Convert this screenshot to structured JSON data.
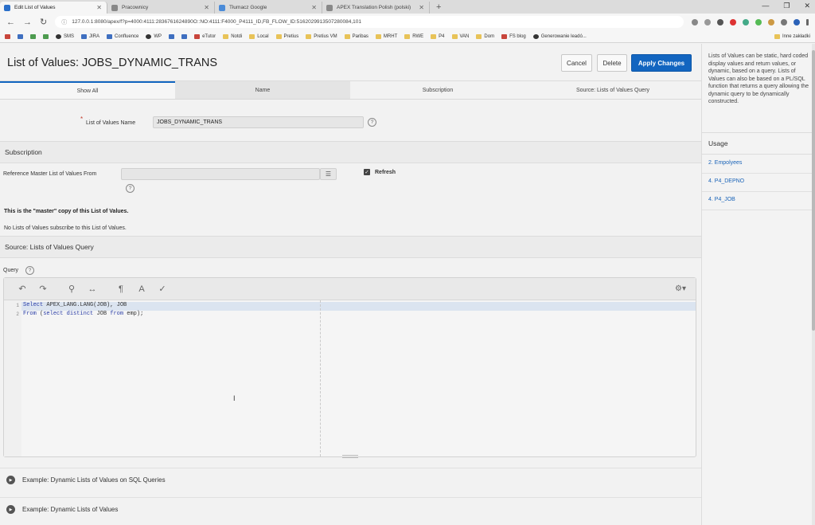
{
  "browser": {
    "tabs": [
      {
        "label": "Edit List of Values"
      },
      {
        "label": "Pracownicy"
      },
      {
        "label": "Tłumacz Google"
      },
      {
        "label": "APEX Translation Polish (polski)"
      }
    ],
    "url": "127.0.0.1:8080/apex/f?p=4000:4111:2836761624890O::NO:4111:F4000_P4111_ID,FB_FLOW_ID:5162029913507280084,101",
    "bookmarks": [
      "SMS",
      "JIRA",
      "Confluence",
      "WP",
      "eTutor",
      "Notdi",
      "Local",
      "Pretius",
      "Pretius VM",
      "Paribas",
      "MRHT",
      "RWE",
      "P4",
      "VAN",
      "Dom",
      "FS blog",
      "Generowanie leadó..."
    ],
    "other_bookmarks": "Inne zakładki"
  },
  "page": {
    "title": "List of Values: JOBS_DYNAMIC_TRANS",
    "buttons": {
      "cancel": "Cancel",
      "delete": "Delete",
      "apply": "Apply Changes"
    },
    "tabs": [
      {
        "label": "Show All"
      },
      {
        "label": "Name"
      },
      {
        "label": "Subscription"
      },
      {
        "label": "Source: Lists of Values Query"
      }
    ],
    "name_field": {
      "label": "List of Values Name",
      "value": "JOBS_DYNAMIC_TRANS"
    },
    "subscription": {
      "heading": "Subscription",
      "ref_label": "Reference Master List of Values From",
      "ref_value": "",
      "refresh_label": "Refresh",
      "master_note": "This is the \"master\" copy of this List of Values.",
      "no_subscribe_note": "No Lists of Values subscribe to this List of Values."
    },
    "source": {
      "heading": "Source: Lists of Values Query",
      "query_label": "Query",
      "line1_no": "1",
      "line2_no": "2",
      "line1_kw": "Select",
      "line1_rest": " APEX_LANG.LANG(JOB), JOB",
      "line2_kw1": "From",
      "line2_mid1": " (",
      "line2_kw2": "select distinct",
      "line2_mid2": " JOB ",
      "line2_kw3": "from",
      "line2_end": " emp);"
    },
    "examples": [
      {
        "label": "Example: Dynamic Lists of Values on SQL Queries"
      },
      {
        "label": "Example: Dynamic Lists of Values"
      }
    ]
  },
  "sidebar": {
    "help_text": "Lists of Values can be static, hard coded display values and return values, or dynamic, based on a query. Lists of Values can also be based on a PL/SQL function that returns a query allowing the dynamic query to be dynamically constructed.",
    "usage_heading": "Usage",
    "usage_links": [
      "2. Empolyees",
      "4. P4_DEPNO",
      "4. P4_JOB"
    ]
  }
}
